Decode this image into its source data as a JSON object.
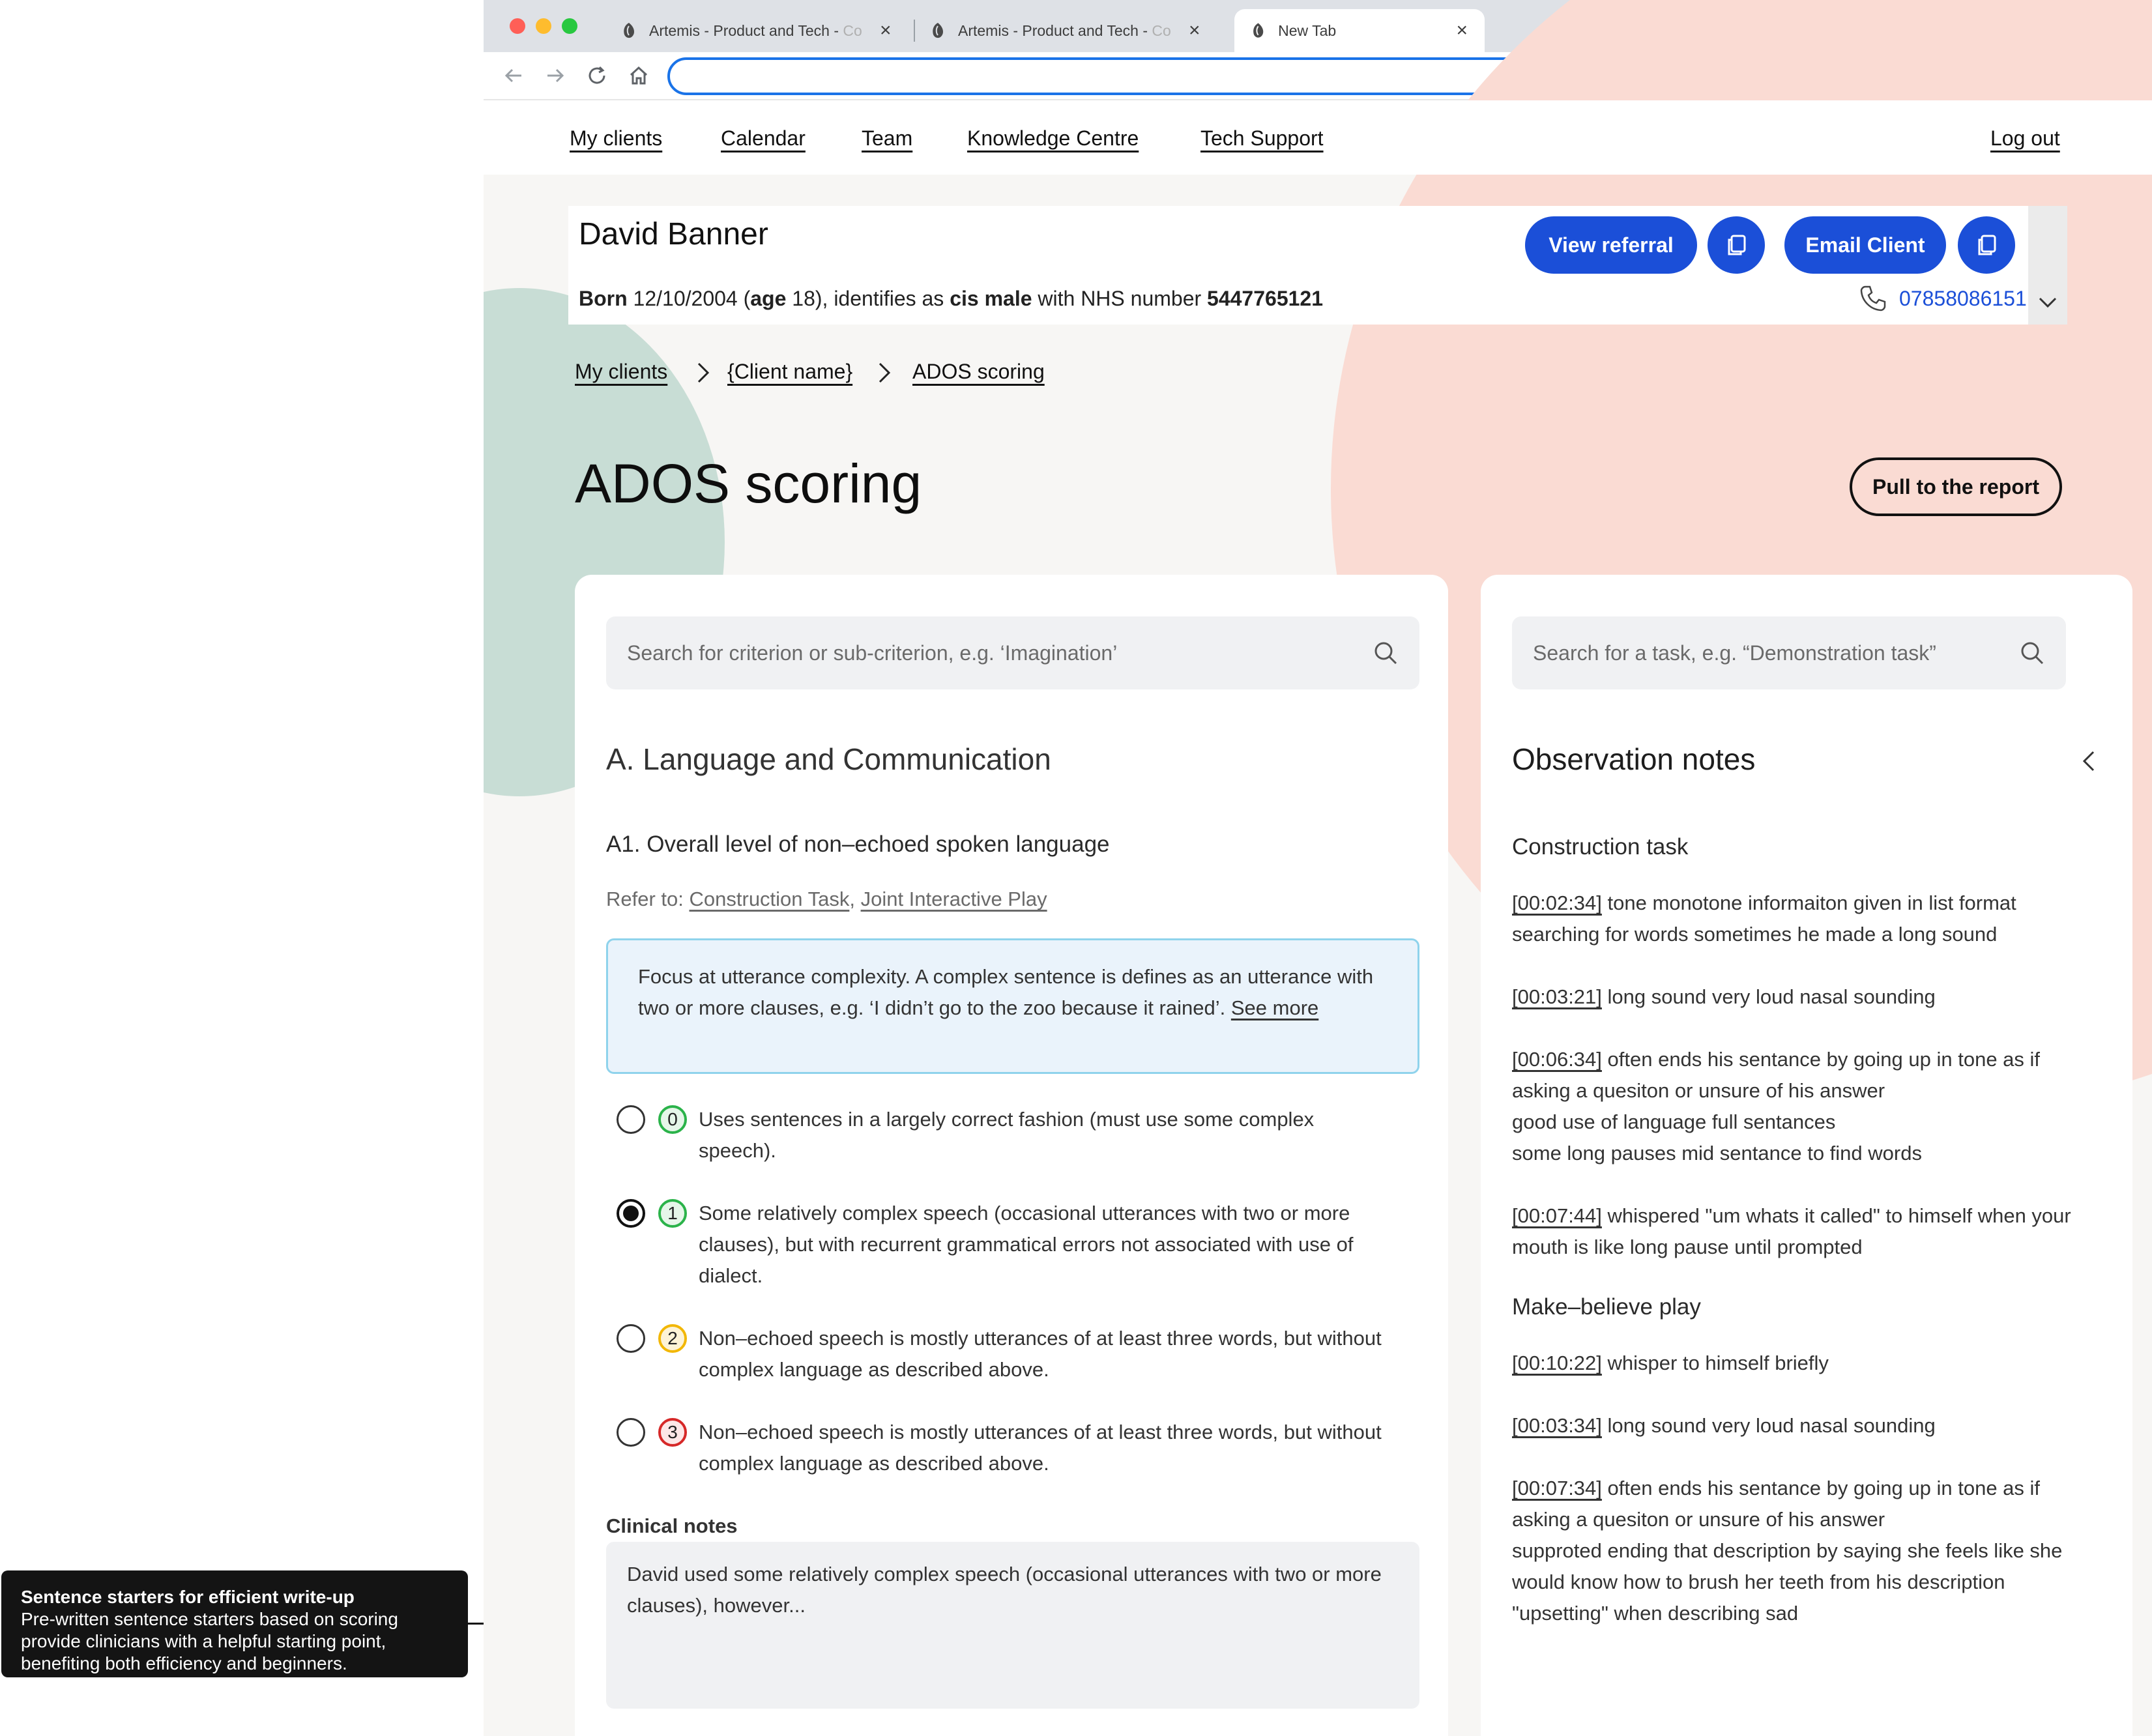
{
  "browser": {
    "tabs": [
      {
        "title": "Artemis - Product and Tech - ",
        "title_fade": "Co",
        "favicon": "artemis-logo-icon"
      },
      {
        "title": "Artemis - Product and Tech - ",
        "title_fade": "Co",
        "favicon": "artemis-logo-icon"
      },
      {
        "title": "New Tab",
        "title_fade": "",
        "favicon": "artemis-logo-icon"
      }
    ],
    "address": ""
  },
  "nav": {
    "links": [
      "My clients",
      "Calendar",
      "Team",
      "Knowledge Centre",
      "Tech Support"
    ],
    "logout": "Log out"
  },
  "client": {
    "name": "David Banner",
    "born_label": "Born",
    "dob": "12/10/2004",
    "age_prefix": "(",
    "age_label": "age",
    "age": "18",
    "identifies_text": "), identifies as",
    "gender": "cis male",
    "nhs_text": "with NHS number",
    "nhs_number": "5447765121",
    "phone": "07858086151",
    "view_referral_label": "View referral",
    "email_client_label": "Email Client"
  },
  "breadcrumb": [
    "My clients",
    "{Client name}",
    "ADOS scoring"
  ],
  "page": {
    "title": "ADOS scoring",
    "pull_button": "Pull to the report"
  },
  "criteria_panel": {
    "search_placeholder": "Search for criterion or sub-criterion, e.g. ‘Imagination’",
    "section_title": "A. Language and Communication",
    "criterion_title": "A1. Overall level of non–echoed spoken language",
    "refer_label": "Refer to:",
    "refer_links": [
      "Construction Task",
      "Joint Interactive Play"
    ],
    "focus_text": "Focus at utterance complexity. A complex sentence is defines as an utterance with two or more clauses, e.g. ‘I didn’t go to the zoo because it rained’.",
    "focus_link": "See more",
    "options": [
      {
        "score": "0",
        "color": "#2bb34a",
        "fill": "#e6f6e9",
        "checked": false,
        "text": "Uses sentences in a largely correct fashion (must use some complex speech)."
      },
      {
        "score": "1",
        "color": "#2bb34a",
        "fill": "#e6f6e9",
        "checked": true,
        "text": "Some relatively complex speech (occasional utterances with two or more clauses), but with recurrent grammatical errors not associated with use of dialect."
      },
      {
        "score": "2",
        "color": "#f2b705",
        "fill": "#fdf3d6",
        "checked": false,
        "text": "Non–echoed speech is mostly utterances of at least three words, but without complex language as described above."
      },
      {
        "score": "3",
        "color": "#d62828",
        "fill": "#fde7e7",
        "checked": false,
        "text": "Non–echoed speech is mostly utterances of at least three words, but without complex language as described above."
      }
    ],
    "clinical_notes_label": "Clinical notes",
    "clinical_notes_text": "David used some relatively complex speech (occasional utterances with two or more clauses), however..."
  },
  "observation_panel": {
    "search_placeholder": "Search for a task, e.g. “Demonstration task”",
    "title": "Observation notes",
    "groups": [
      {
        "title": "Construction task",
        "entries": [
          {
            "timestamp": "[00:02:34]",
            "text": " tone monotone informaiton given in list format searching for words sometimes he made a long sound"
          },
          {
            "timestamp": "[00:03:21]",
            "text": " long sound very loud nasal sounding"
          },
          {
            "timestamp": "[00:06:34]",
            "text": " often ends his sentance by going up in tone as if asking a quesiton or unsure of his answer\ngood use of language full sentances\nsome long pauses mid sentance to find words"
          },
          {
            "timestamp": "[00:07:44]",
            "text": " whispered \"um whats it called\" to himself when your mouth is like long pause until prompted"
          }
        ]
      },
      {
        "title": "Make–believe play",
        "entries": [
          {
            "timestamp": "[00:10:22]",
            "text": " whisper to himself briefly"
          },
          {
            "timestamp": "[00:03:34]",
            "text": " long sound very loud nasal sounding"
          },
          {
            "timestamp": "[00:07:34]",
            "text": " often ends his sentance by going up in tone as if asking a quesiton or unsure of his answer\nsupproted ending that description by saying she feels like she would know how to brush her teeth from his description\n \"upsetting\" when describing sad"
          }
        ]
      }
    ]
  },
  "annotation": {
    "title": "Sentence starters for efficient write-up",
    "body": "Pre-written sentence starters based on scoring provide clinicians with a helpful starting point, benefiting both efficiency and beginners."
  },
  "colors": {
    "primary": "#1b4fd8",
    "blob_green": "#c8ddd5",
    "blob_pink": "#fadbd3",
    "focus_bg": "#eaf3fb",
    "focus_border": "#8fd3ec"
  }
}
